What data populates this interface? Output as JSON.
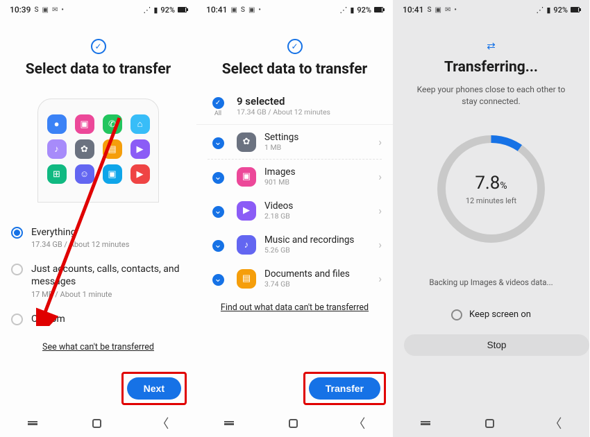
{
  "colors": {
    "primary": "#1672e6",
    "danger": "#e00000"
  },
  "panel1": {
    "status": {
      "time": "10:39",
      "battery": "92%",
      "icons": [
        "S",
        "▣",
        "✉",
        "•"
      ]
    },
    "title": "Select data to transfer",
    "apps": [
      {
        "bg": "#3b82f6",
        "glyph": "●"
      },
      {
        "bg": "#ec4899",
        "glyph": "▣"
      },
      {
        "bg": "#22c55e",
        "glyph": "✆"
      },
      {
        "bg": "#38bdf8",
        "glyph": "⌂"
      },
      {
        "bg": "#a78bfa",
        "glyph": "♪"
      },
      {
        "bg": "#6b7280",
        "glyph": "✿"
      },
      {
        "bg": "#f59e0b",
        "glyph": "▤"
      },
      {
        "bg": "#8b5cf6",
        "glyph": "▶"
      },
      {
        "bg": "#10b981",
        "glyph": "⊞"
      },
      {
        "bg": "#6366f1",
        "glyph": "☺"
      },
      {
        "bg": "#0ea5e9",
        "glyph": "▣"
      },
      {
        "bg": "#ef4444",
        "glyph": "▶"
      }
    ],
    "options": [
      {
        "label": "Everything",
        "sub": "17.34 GB / About 12 minutes",
        "selected": true
      },
      {
        "label": "Just accounts, calls, contacts, and messages",
        "sub": "17 MB / About 1 minute",
        "selected": false
      },
      {
        "label": "Custom",
        "sub": "",
        "selected": false
      }
    ],
    "link": "See what can't be transferred",
    "cta": "Next"
  },
  "panel2": {
    "status": {
      "time": "10:41",
      "battery": "92%",
      "icons": [
        "▣",
        "S",
        "▣",
        "•"
      ]
    },
    "title": "Select data to transfer",
    "all": {
      "label": "All",
      "title": "9 selected",
      "sub": "17.34 GB / About 12 minutes"
    },
    "items": [
      {
        "icon_bg": "#6b7280",
        "glyph": "✿",
        "title": "Settings",
        "sub": "1 MB"
      },
      {
        "icon_bg": "#ec4899",
        "glyph": "▣",
        "title": "Images",
        "sub": "901 MB"
      },
      {
        "icon_bg": "#8b5cf6",
        "glyph": "▶",
        "title": "Videos",
        "sub": "2.18 GB"
      },
      {
        "icon_bg": "#6366f1",
        "glyph": "♪",
        "title": "Music and recordings",
        "sub": "5.26 GB"
      },
      {
        "icon_bg": "#f59e0b",
        "glyph": "▤",
        "title": "Documents and files",
        "sub": "3.74 GB"
      }
    ],
    "link": "Find out what data can't be transferred",
    "cta": "Transfer"
  },
  "panel3": {
    "status": {
      "time": "10:41",
      "battery": "92%",
      "icons": [
        "S",
        "▣",
        "✉",
        "•"
      ]
    },
    "title": "Transferring...",
    "subtitle": "Keep your phones close to each other to stay connected.",
    "percent": "7.8",
    "percent_suffix": "%",
    "time_left": "12 minutes left",
    "status_text": "Backing up Images & videos data...",
    "keep_screen": "Keep screen on",
    "stop": "Stop"
  }
}
